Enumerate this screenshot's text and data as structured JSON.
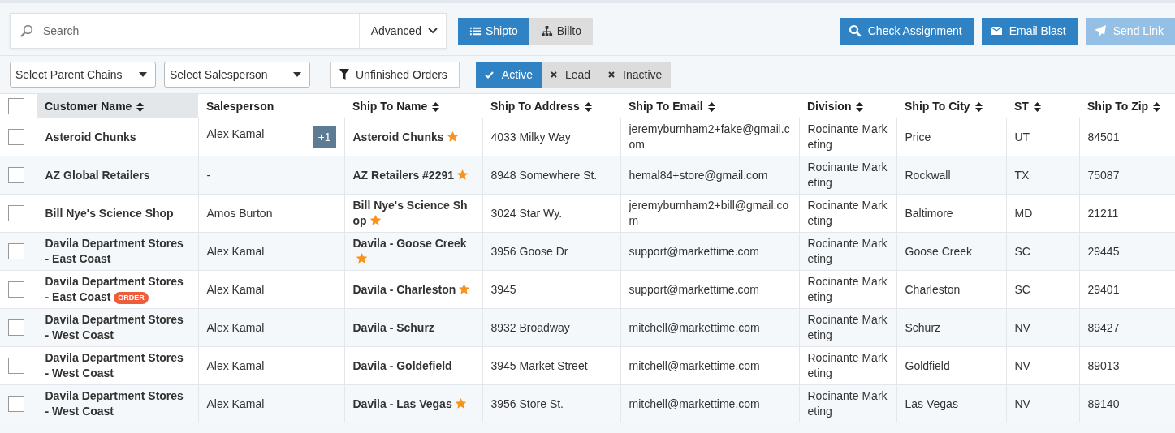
{
  "search": {
    "placeholder": "Search",
    "advanced_label": "Advanced"
  },
  "view_toggle": [
    {
      "label": "Shipto",
      "selected": true
    },
    {
      "label": "Billto",
      "selected": false
    }
  ],
  "actions": [
    {
      "label": "Check Assignment",
      "disabled": false
    },
    {
      "label": "Email Blast",
      "disabled": false
    },
    {
      "label": "Send Link",
      "disabled": true
    }
  ],
  "filters": {
    "parent_chains": "Select Parent Chains",
    "salesperson": "Select Salesperson",
    "unfinished_orders": "Unfinished Orders"
  },
  "status_toggle": [
    {
      "label": "Active",
      "selected": true
    },
    {
      "label": "Lead",
      "selected": false
    },
    {
      "label": "Inactive",
      "selected": false
    }
  ],
  "table": {
    "select_all_checked": false,
    "columns": [
      {
        "label": "Customer Name",
        "sortable": true,
        "sorted": true
      },
      {
        "label": "Salesperson",
        "sortable": false,
        "sorted": false
      },
      {
        "label": "Ship To Name",
        "sortable": true,
        "sorted": false
      },
      {
        "label": "Ship To Address",
        "sortable": true,
        "sorted": false
      },
      {
        "label": "Ship To Email",
        "sortable": true,
        "sorted": false
      },
      {
        "label": "Division",
        "sortable": true,
        "sorted": false
      },
      {
        "label": "Ship To City",
        "sortable": true,
        "sorted": false
      },
      {
        "label": "ST",
        "sortable": true,
        "sorted": false
      },
      {
        "label": "Ship To Zip",
        "sortable": true,
        "sorted": false
      }
    ],
    "rows": [
      {
        "checked": false,
        "customer": "Asteroid Chunks",
        "salesperson": "Alex Kamal",
        "extra": "+1",
        "ship_to_name": "Asteroid Chunks",
        "starred": true,
        "address": "4033 Milky Way",
        "email": "jeremyburnham2+fake@gmail.com",
        "division": "Rocinante Marketing",
        "city": "Price",
        "st": "UT",
        "zip": "84501"
      },
      {
        "checked": false,
        "customer": "AZ Global Retailers",
        "salesperson": "-",
        "ship_to_name": "AZ Retailers #2291",
        "starred": true,
        "address": "8948 Somewhere St.",
        "email": "hemal84+store@gmail.com",
        "division": "Rocinante Marketing",
        "city": "Rockwall",
        "st": "TX",
        "zip": "75087"
      },
      {
        "checked": false,
        "customer": "Bill Nye's Science Shop",
        "salesperson": "Amos Burton",
        "ship_to_name": "Bill Nye's Science Shop",
        "starred": true,
        "address": "3024 Star Wy.",
        "email": "jeremyburnham2+bill@gmail.com",
        "division": "Rocinante Marketing",
        "city": "Baltimore",
        "st": "MD",
        "zip": "21211"
      },
      {
        "checked": false,
        "customer": "Davila Department Stores - East Coast",
        "salesperson": "Alex Kamal",
        "ship_to_name": "Davila - Goose Creek",
        "starred": true,
        "address": "3956 Goose Dr",
        "email": "support@markettime.com",
        "division": "Rocinante Marketing",
        "city": "Goose Creek",
        "st": "SC",
        "zip": "29445"
      },
      {
        "checked": false,
        "customer": "Davila Department Stores - East Coast",
        "order_badge": "ORDER",
        "salesperson": "Alex Kamal",
        "ship_to_name": "Davila - Charleston",
        "starred": true,
        "address": "3945",
        "email": "support@markettime.com",
        "division": "Rocinante Marketing",
        "city": "Charleston",
        "st": "SC",
        "zip": "29401"
      },
      {
        "checked": false,
        "customer": "Davila Department Stores - West Coast",
        "salesperson": "Alex Kamal",
        "ship_to_name": "Davila - Schurz",
        "starred": false,
        "address": "8932 Broadway",
        "email": "mitchell@markettime.com",
        "division": "Rocinante Marketing",
        "city": "Schurz",
        "st": "NV",
        "zip": "89427"
      },
      {
        "checked": false,
        "customer": "Davila Department Stores - West Coast",
        "salesperson": "Alex Kamal",
        "ship_to_name": "Davila - Goldefield",
        "starred": false,
        "address": "3945 Market Street",
        "email": "mitchell@markettime.com",
        "division": "Rocinante Marketing",
        "city": "Goldfield",
        "st": "NV",
        "zip": "89013"
      },
      {
        "checked": false,
        "customer": "Davila Department Stores - West Coast",
        "salesperson": "Alex Kamal",
        "ship_to_name": "Davila - Las Vegas",
        "starred": true,
        "address": "3956 Store St.",
        "email": "mitchell@markettime.com",
        "division": "Rocinante Marketing",
        "city": "Las Vegas",
        "st": "NV",
        "zip": "89140"
      }
    ]
  }
}
